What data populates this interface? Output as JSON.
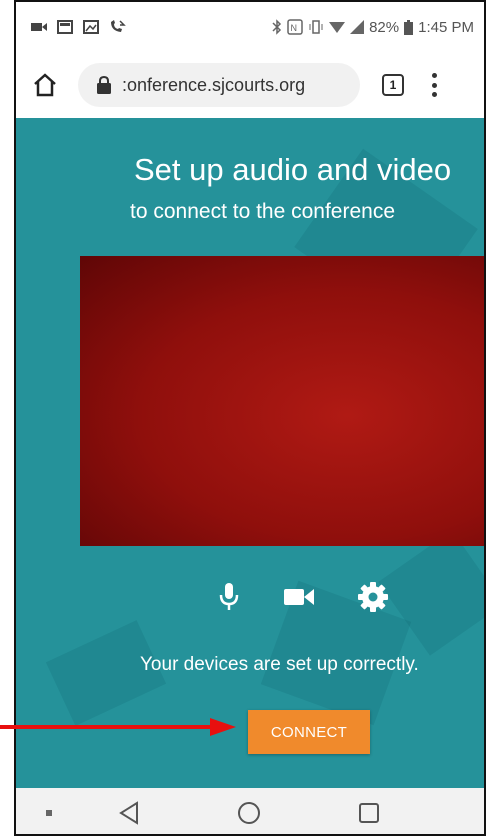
{
  "statusbar": {
    "left_icons": [
      "video-notification-icon",
      "gallery-notification-icon",
      "photo-notification-icon",
      "missed-call-icon"
    ],
    "right_icons": [
      "bluetooth-icon",
      "nfc-icon",
      "vibrate-icon",
      "wifi-icon",
      "signal-icon"
    ],
    "battery": "82%",
    "time": "1:45 PM"
  },
  "browser": {
    "url": ":onference.sjcourts.org",
    "tab_count": "1"
  },
  "page": {
    "title": "Set up audio and video",
    "subtitle": "to connect to the conference",
    "video_color": "#8f0f0c",
    "controls": [
      "microphone-icon",
      "camera-icon",
      "settings-icon"
    ],
    "status": "Your devices are set up correctly.",
    "connect_label": "CONNECT",
    "background_color": "#25929a",
    "button_color": "#f08a2c"
  },
  "annotation": {
    "arrow_color": "#e8100f"
  },
  "navbar": {
    "buttons": [
      "recent-apps-dot",
      "back-icon",
      "home-icon",
      "overview-icon"
    ]
  }
}
